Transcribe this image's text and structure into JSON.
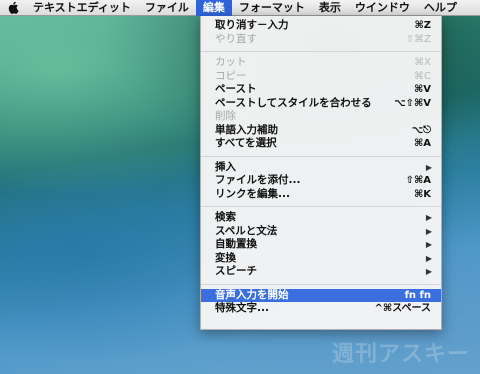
{
  "menubar": {
    "apple_icon": "apple-logo-icon",
    "items": [
      {
        "label": "テキストエディット"
      },
      {
        "label": "ファイル"
      },
      {
        "label": "編集"
      },
      {
        "label": "フォーマット"
      },
      {
        "label": "表示"
      },
      {
        "label": "ウインドウ"
      },
      {
        "label": "ヘルプ"
      }
    ],
    "active_index": 2
  },
  "edit_menu": {
    "undo": {
      "label": "取り消す－入力",
      "shortcut": "⌘Z"
    },
    "redo": {
      "label": "やり直す",
      "shortcut": "⇧⌘Z"
    },
    "cut": {
      "label": "カット",
      "shortcut": "⌘X"
    },
    "copy": {
      "label": "コピー",
      "shortcut": "⌘C"
    },
    "paste": {
      "label": "ペースト",
      "shortcut": "⌘V"
    },
    "paste_match": {
      "label": "ペーストしてスタイルを合わせる",
      "shortcut": "⌥⇧⌘V"
    },
    "delete": {
      "label": "削除"
    },
    "complete": {
      "label": "単語入力補助",
      "shortcut": "⌥⎋"
    },
    "select_all": {
      "label": "すべてを選択",
      "shortcut": "⌘A"
    },
    "insert": {
      "label": "挿入"
    },
    "attach": {
      "label": "ファイルを添付...",
      "shortcut": "⇧⌘A"
    },
    "edit_link": {
      "label": "リンクを編集...",
      "shortcut": "⌘K"
    },
    "find": {
      "label": "検索"
    },
    "spelling": {
      "label": "スペルと文法"
    },
    "substitutions": {
      "label": "自動置換"
    },
    "transformations": {
      "label": "変換"
    },
    "speech": {
      "label": "スピーチ"
    },
    "dictation": {
      "label": "音声入力を開始",
      "shortcut": "fn fn"
    },
    "special_chars": {
      "label": "特殊文字...",
      "shortcut": "^⌘スペース"
    }
  },
  "watermark": "週刊アスキー"
}
